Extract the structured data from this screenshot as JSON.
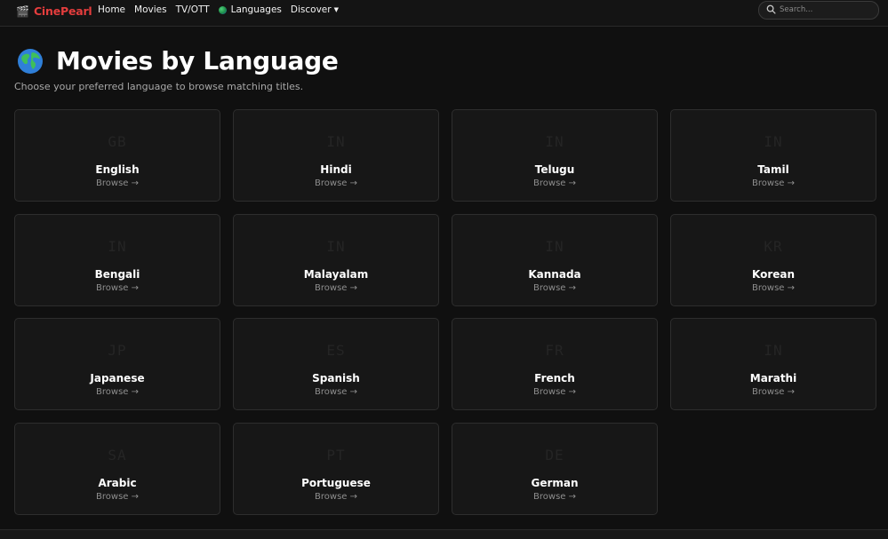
{
  "nav": {
    "brand_icon": "🎬",
    "brand_name": "CinePearl",
    "links": [
      "Home",
      "Movies",
      "TV/OTT",
      "Languages",
      "Discover"
    ],
    "search_placeholder": "Search..."
  },
  "page": {
    "title": "Movies by Language",
    "subtitle": "Choose your preferred language to browse matching titles."
  },
  "browse_label": "Browse →",
  "languages": [
    {
      "code": "GB",
      "name": "English"
    },
    {
      "code": "IN",
      "name": "Hindi"
    },
    {
      "code": "IN",
      "name": "Telugu"
    },
    {
      "code": "IN",
      "name": "Tamil"
    },
    {
      "code": "IN",
      "name": "Bengali"
    },
    {
      "code": "IN",
      "name": "Malayalam"
    },
    {
      "code": "IN",
      "name": "Kannada"
    },
    {
      "code": "KR",
      "name": "Korean"
    },
    {
      "code": "JP",
      "name": "Japanese"
    },
    {
      "code": "ES",
      "name": "Spanish"
    },
    {
      "code": "FR",
      "name": "French"
    },
    {
      "code": "IN",
      "name": "Marathi"
    },
    {
      "code": "SA",
      "name": "Arabic"
    },
    {
      "code": "PT",
      "name": "Portuguese"
    },
    {
      "code": "DE",
      "name": "German"
    }
  ],
  "colors": {
    "brand": "#e43d3d",
    "background": "#101010",
    "card": "#171717"
  }
}
